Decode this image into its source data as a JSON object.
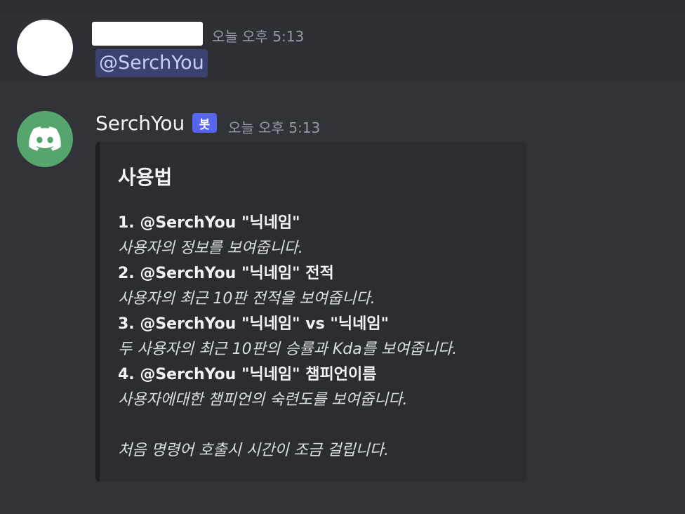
{
  "message1": {
    "timestamp": "오늘 오후 5:13",
    "mention": "@SerchYou"
  },
  "message2": {
    "author": "SerchYou",
    "badge": "봇",
    "timestamp": "오늘 오후 5:13",
    "embed": {
      "title": "사용법",
      "lines": [
        "1. @SerchYou \"닉네임\"",
        "사용자의 정보를 보여줍니다.",
        "2. @SerchYou \"닉네임\" 전적",
        "사용자의 최근 10판 전적을 보여줍니다.",
        "3. @SerchYou \"닉네임\" vs \"닉네임\"",
        "두 사용자의 최근 10판의 승률과 Kda를 보여줍니다.",
        "4. @SerchYou \"닉네임\" 챔피언이름",
        "사용자에대한 챔피언의 숙련도를 보여줍니다."
      ],
      "footer": "처음 명령어 호출시 시간이 조금 걸립니다."
    }
  },
  "icons": {
    "bot_avatar": "discord-logo-icon"
  },
  "colors": {
    "background": "#313338",
    "bot_avatar": "#56a56c",
    "mention_bg": "#3c4270",
    "mention_text": "#c9cdfb",
    "badge": "#5865f2"
  }
}
